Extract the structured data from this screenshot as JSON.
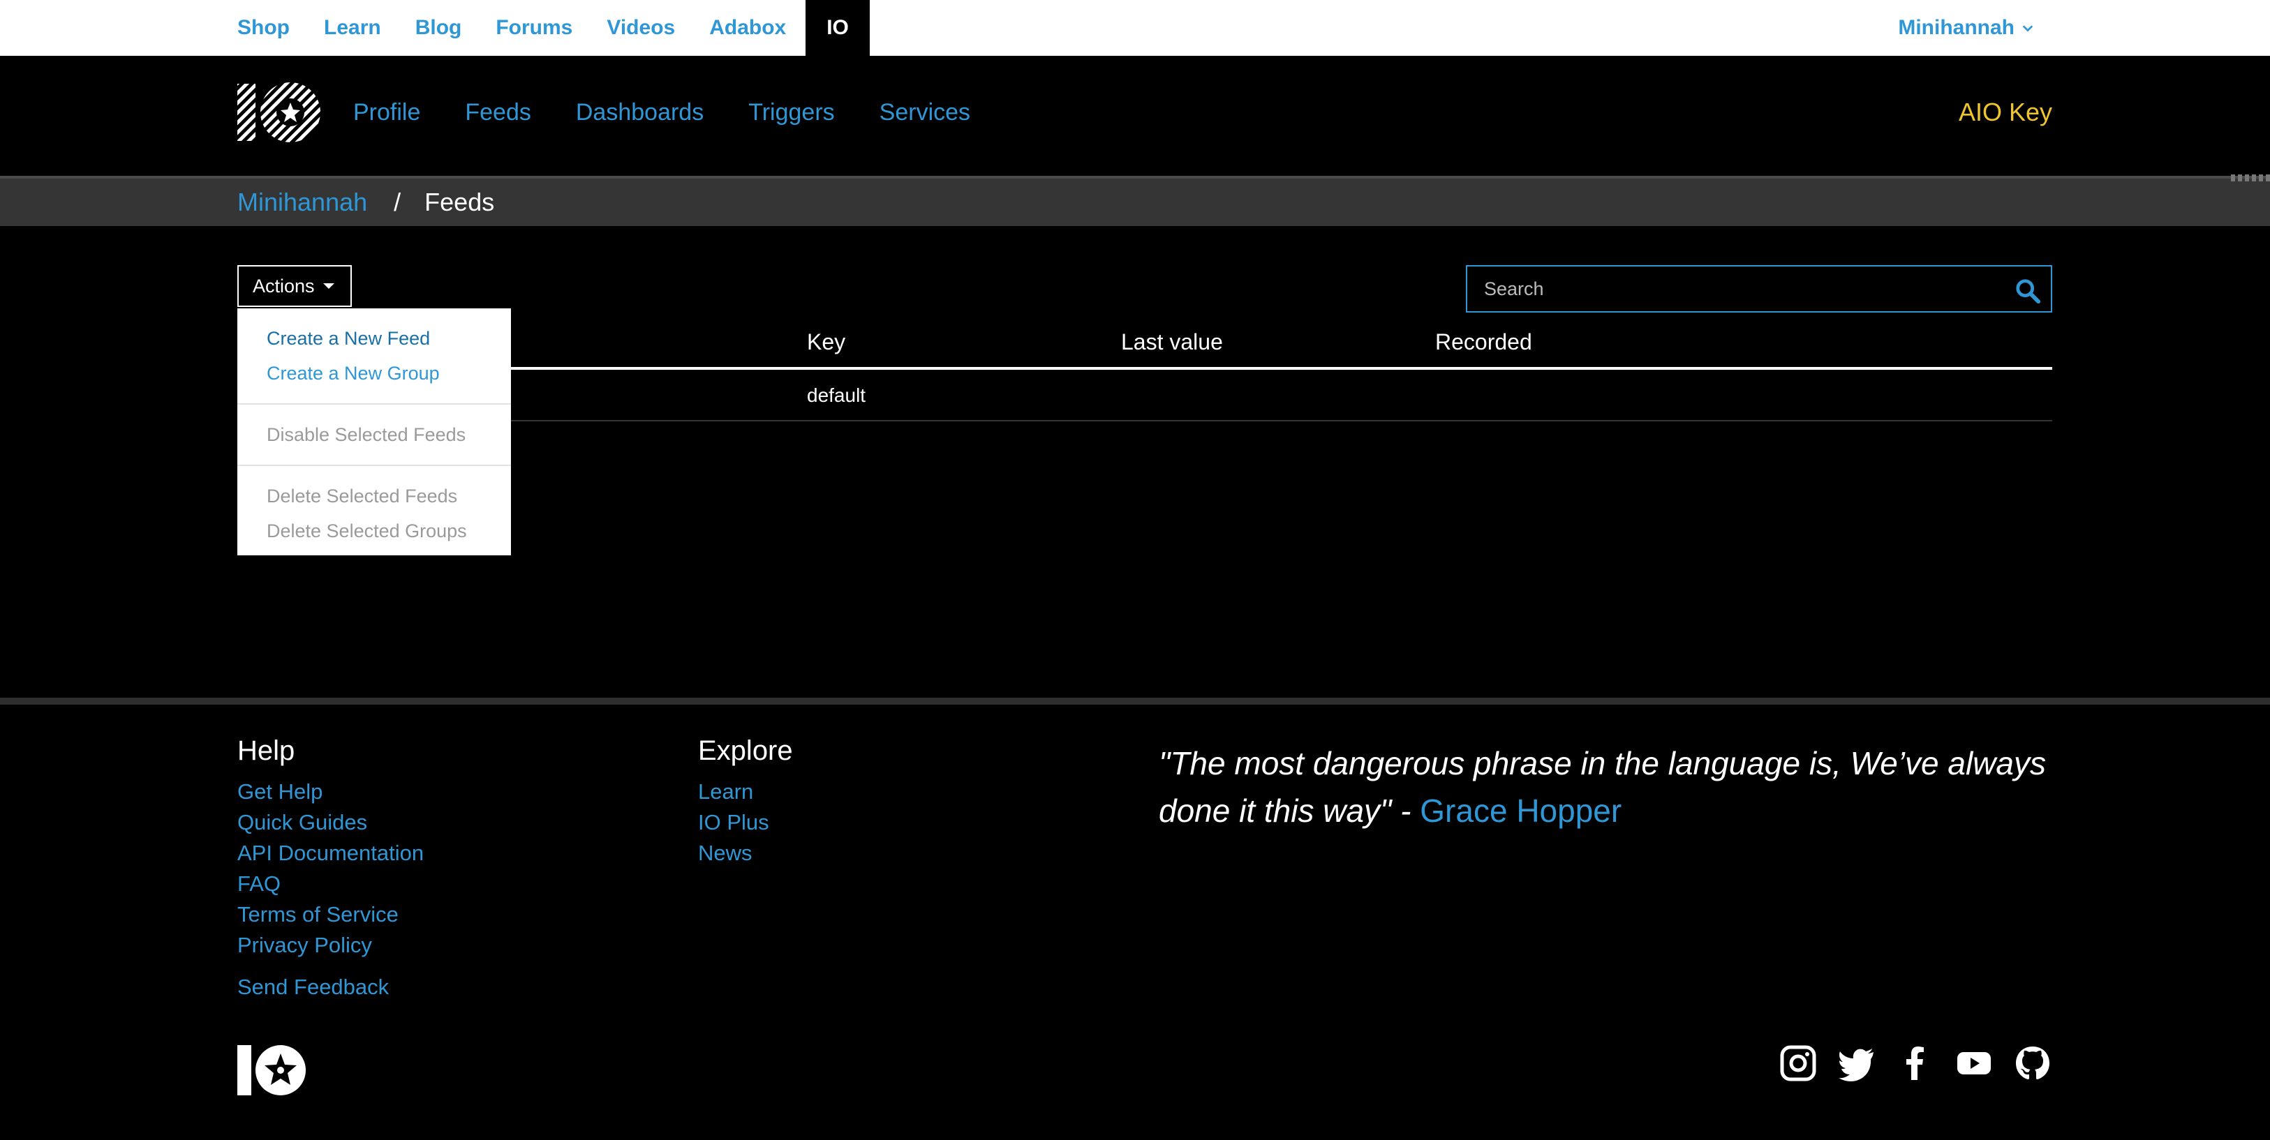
{
  "topnav": {
    "items": [
      {
        "label": "Shop"
      },
      {
        "label": "Learn"
      },
      {
        "label": "Blog"
      },
      {
        "label": "Forums"
      },
      {
        "label": "Videos"
      },
      {
        "label": "Adabox"
      },
      {
        "label": "IO"
      }
    ],
    "active": "IO",
    "user": "Minihannah"
  },
  "header": {
    "nav": [
      {
        "label": "Profile"
      },
      {
        "label": "Feeds"
      },
      {
        "label": "Dashboards"
      },
      {
        "label": "Triggers"
      },
      {
        "label": "Services"
      }
    ],
    "aio_key": "AIO Key"
  },
  "breadcrumb": {
    "user": "Minihannah",
    "separator": "/",
    "current": "Feeds"
  },
  "actions": {
    "label": "Actions",
    "menu": [
      {
        "label": "Create a New Feed",
        "enabled": true
      },
      {
        "label": "Create a New Group",
        "enabled": true
      },
      {
        "label": "Disable Selected Feeds",
        "enabled": false
      },
      {
        "label": "Delete Selected Feeds",
        "enabled": false
      },
      {
        "label": "Delete Selected Groups",
        "enabled": false
      }
    ]
  },
  "search": {
    "placeholder": "Search",
    "value": ""
  },
  "table": {
    "columns": [
      "Key",
      "Last value",
      "Recorded"
    ],
    "rows": [
      {
        "key": "default",
        "last_value": "",
        "recorded": ""
      }
    ]
  },
  "footer": {
    "help": {
      "title": "Help",
      "links": [
        "Get Help",
        "Quick Guides",
        "API Documentation",
        "FAQ",
        "Terms of Service",
        "Privacy Policy"
      ],
      "feedback": "Send Feedback"
    },
    "explore": {
      "title": "Explore",
      "links": [
        "Learn",
        "IO Plus",
        "News"
      ]
    },
    "quote": {
      "text": "\"The most dangerous phrase in the language is, We’ve always done it this way\" - ",
      "author": "Grace Hopper"
    },
    "social_icons": [
      "instagram-icon",
      "twitter-icon",
      "facebook-icon",
      "youtube-icon",
      "github-icon"
    ]
  },
  "colors": {
    "link": "#2f97d6",
    "aio_key": "#f0c42c",
    "background": "#000000",
    "breadcrumb_bar": "#353535"
  }
}
